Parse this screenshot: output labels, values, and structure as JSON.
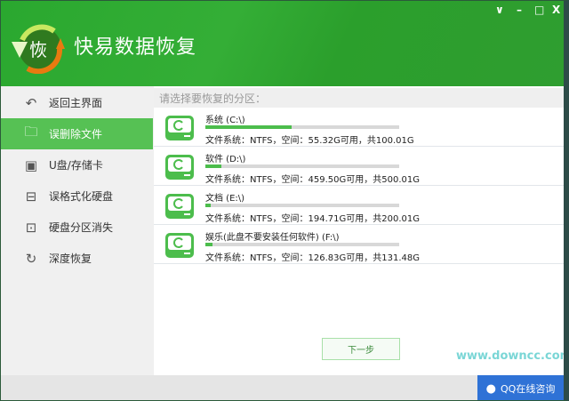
{
  "app": {
    "title": "快易数据恢复",
    "logo_text": "恢"
  },
  "window_controls": {
    "menu": "∨",
    "minimize": "–",
    "maximize": "□",
    "close": "X"
  },
  "sidebar": {
    "items": [
      {
        "label": "返回主界面",
        "icon": "back-arrow-icon",
        "active": false
      },
      {
        "label": "误删除文件",
        "icon": "folder-icon",
        "active": true
      },
      {
        "label": "U盘/存储卡",
        "icon": "usb-drive-icon",
        "active": false
      },
      {
        "label": "误格式化硬盘",
        "icon": "hard-disk-icon",
        "active": false
      },
      {
        "label": "硬盘分区消失",
        "icon": "disk-partition-icon",
        "active": false
      },
      {
        "label": "深度恢复",
        "icon": "deep-scan-icon",
        "active": false
      }
    ]
  },
  "main": {
    "section_title": "请选择要恢复的分区：",
    "partitions": [
      {
        "name": "系统 (C:\\)",
        "info": "文件系统：NTFS，空间：55.32G可用，共100.01G",
        "used_fraction": 0.447
      },
      {
        "name": "软件 (D:\\)",
        "info": "文件系统：NTFS，空间：459.50G可用，共500.01G",
        "used_fraction": 0.081
      },
      {
        "name": "文档 (E:\\)",
        "info": "文件系统：NTFS，空间：194.71G可用，共200.01G",
        "used_fraction": 0.026
      },
      {
        "name": "娱乐(此盘不要安装任何软件) (F:\\)",
        "info": "文件系统：NTFS，空间：126.83G可用，共131.48G",
        "used_fraction": 0.035
      }
    ],
    "next_button": "下一步",
    "watermark": "www.downcc.com"
  },
  "footer": {
    "qq_button": "QQ在线咨询"
  },
  "colors": {
    "header_green": "#2ea830",
    "accent_green": "#56c154",
    "qq_blue": "#2f72d6"
  }
}
